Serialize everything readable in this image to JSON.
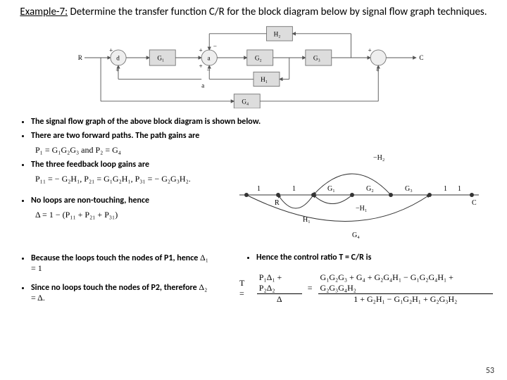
{
  "title_prefix": "Example-7:",
  "title_rest": " Determine the transfer function C/R for the block diagram below by signal flow graph techniques.",
  "block": {
    "R": "R",
    "C": "C",
    "G1": "G₁",
    "G2": "G₂",
    "G3": "G₃",
    "G4": "G₄",
    "H1": "H₁",
    "H2": "H₂",
    "a": "a",
    "d": "d"
  },
  "bul1": "The signal flow graph of the above block diagram is shown below.",
  "bul2": "There are two forward paths. The path gains are",
  "eq_paths": "P₁ = G₁G₂G₃  and  P₂ = G₄",
  "bul3": "The three feedback loop gains are",
  "eq_loops": "P₁₁ = − G₂H₁,  P₂₁ = G₁G₂H₁,  P₃₁ = − G₂G₃H₂.",
  "bul4": "No loops are non-touching, hence",
  "eq_delta": "Δ = 1 − (P₁₁ + P₂₁ + P₃₁)",
  "bul5": "Because the loops touch the nodes of P1, hence",
  "eq_d1": "Δ₁ = 1",
  "bul6": "Since no loops touch the nodes of P2, therefore",
  "eq_d2": "Δ₂ = Δ.",
  "bul7": "Hence the control ratio T = C/R is",
  "ratio": {
    "T": "T =",
    "num1": "P₁Δ₁ + P₂Δ₂",
    "den1": "Δ",
    "eq": "=",
    "num2": "G₁G₂G₃ + G₄ + G₂G₄H₁ − G₁G₂G₄H₁ + G₂G₃G₄H₂",
    "den2": "1 + G₂H₁ − G₁G₂H₁ + G₂G₃H₂"
  },
  "sfg": {
    "nodes": [
      "1",
      "1",
      "G₁",
      "G₂",
      "G₃",
      "1",
      "1"
    ],
    "R": "R",
    "C": "C",
    "mH2": "−H₂",
    "mH1": "−H₁",
    "H1": "H₁",
    "G4": "G₄"
  },
  "pagenum": "53"
}
